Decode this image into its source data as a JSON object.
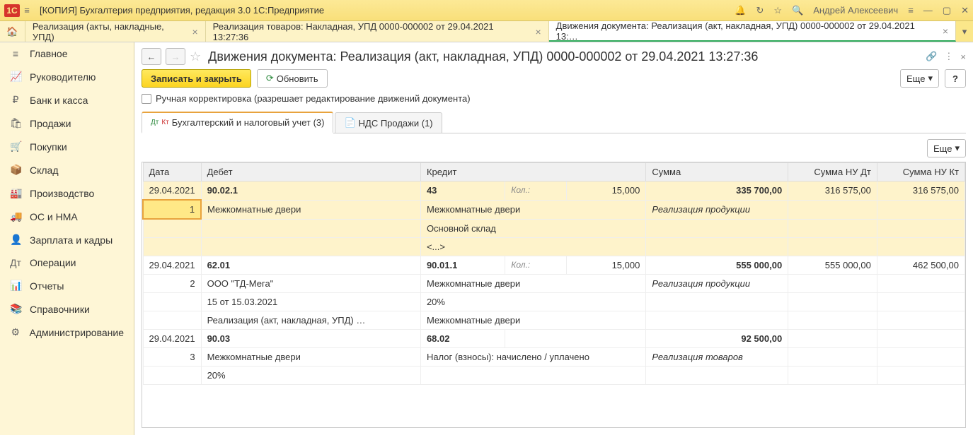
{
  "titlebar": {
    "app_title": "[КОПИЯ] Бухгалтерия предприятия, редакция 3.0 1С:Предприятие",
    "user": "Андрей Алексеевич"
  },
  "tabs": [
    {
      "label": "Реализация (акты, накладные, УПД)"
    },
    {
      "label": "Реализация товаров: Накладная, УПД 0000-000002 от 29.04.2021 13:27:36"
    },
    {
      "label": "Движения документа: Реализация (акт, накладная, УПД) 0000-000002 от 29.04.2021 13:…",
      "active": true
    }
  ],
  "sidebar": [
    {
      "icon": "≡",
      "label": "Главное"
    },
    {
      "icon": "📈",
      "label": "Руководителю"
    },
    {
      "icon": "₽",
      "label": "Банк и касса"
    },
    {
      "icon": "🛍",
      "label": "Продажи"
    },
    {
      "icon": "🛒",
      "label": "Покупки"
    },
    {
      "icon": "📦",
      "label": "Склад"
    },
    {
      "icon": "🏭",
      "label": "Производство"
    },
    {
      "icon": "🚚",
      "label": "ОС и НМА"
    },
    {
      "icon": "👤",
      "label": "Зарплата и кадры"
    },
    {
      "icon": "Дт",
      "label": "Операции"
    },
    {
      "icon": "📊",
      "label": "Отчеты"
    },
    {
      "icon": "📚",
      "label": "Справочники"
    },
    {
      "icon": "⚙",
      "label": "Администрирование"
    }
  ],
  "page": {
    "title": "Движения документа: Реализация (акт, накладная, УПД) 0000-000002 от 29.04.2021 13:27:36",
    "save_label": "Записать и закрыть",
    "refresh_label": "Обновить",
    "more_label": "Еще",
    "checkbox_label": "Ручная корректировка (разрешает редактирование движений документа)",
    "tab1": "Бухгалтерский и налоговый учет (3)",
    "tab2": "НДС Продажи (1)"
  },
  "table": {
    "cols": [
      "Дата",
      "Дебет",
      "Кредит",
      "Сумма",
      "Сумма НУ Дт",
      "Сумма НУ Кт"
    ],
    "rows": [
      {
        "date": "29.04.2021",
        "num": "1",
        "highlight": true,
        "debit_acct": "90.02.1",
        "debit_lines": [
          "Межкомнатные двери"
        ],
        "credit_acct": "43",
        "credit_qty_label": "Кол.:",
        "credit_qty": "15,000",
        "credit_lines": [
          "Межкомнатные двери",
          "Основной склад",
          "<...>"
        ],
        "sum": "335 700,00",
        "sum_desc": "Реализация продукции",
        "nu_dt": "316 575,00",
        "nu_kt": "316 575,00"
      },
      {
        "date": "29.04.2021",
        "num": "2",
        "debit_acct": "62.01",
        "debit_lines": [
          "ООО \"ТД-Мега\"",
          "15 от 15.03.2021",
          "Реализация (акт, накладная, УПД) …"
        ],
        "credit_acct": "90.01.1",
        "credit_qty_label": "Кол.:",
        "credit_qty": "15,000",
        "credit_lines": [
          "Межкомнатные двери",
          "20%",
          "Межкомнатные двери"
        ],
        "sum": "555 000,00",
        "sum_desc": "Реализация продукции",
        "nu_dt": "555 000,00",
        "nu_kt": "462 500,00"
      },
      {
        "date": "29.04.2021",
        "num": "3",
        "debit_acct": "90.03",
        "debit_lines": [
          "Межкомнатные двери",
          "20%"
        ],
        "credit_acct": "68.02",
        "credit_lines": [
          "Налог (взносы): начислено / уплачено"
        ],
        "sum": "92 500,00",
        "sum_desc": "Реализация товаров",
        "nu_dt": "",
        "nu_kt": ""
      }
    ]
  }
}
